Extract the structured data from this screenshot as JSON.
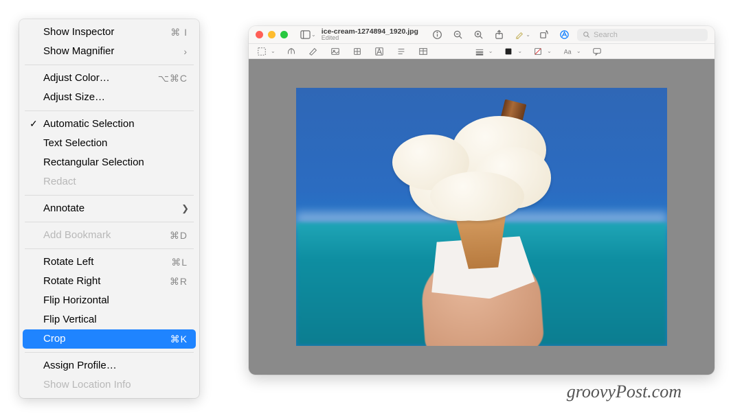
{
  "menu": {
    "groups": [
      [
        {
          "label": "Show Inspector",
          "shortcut": "⌘ I"
        },
        {
          "label": "Show Magnifier",
          "shortcut": "›"
        }
      ],
      [
        {
          "label": "Adjust Color…",
          "shortcut": "⌥⌘C"
        },
        {
          "label": "Adjust Size…"
        }
      ],
      [
        {
          "label": "Automatic Selection",
          "checked": true
        },
        {
          "label": "Text Selection"
        },
        {
          "label": "Rectangular Selection"
        },
        {
          "label": "Redact",
          "disabled": true
        }
      ],
      [
        {
          "label": "Annotate",
          "submenu": true
        }
      ],
      [
        {
          "label": "Add Bookmark",
          "shortcut": "⌘D",
          "disabled": true
        }
      ],
      [
        {
          "label": "Rotate Left",
          "shortcut": "⌘L"
        },
        {
          "label": "Rotate Right",
          "shortcut": "⌘R"
        },
        {
          "label": "Flip Horizontal"
        },
        {
          "label": "Flip Vertical"
        },
        {
          "label": "Crop",
          "shortcut": "⌘K",
          "highlight": true
        }
      ],
      [
        {
          "label": "Assign Profile…"
        },
        {
          "label": "Show Location Info",
          "disabled": true
        }
      ]
    ]
  },
  "window": {
    "filename": "ice-cream-1274894_1920.jpg",
    "subtitle": "Edited",
    "search_placeholder": "Search",
    "toolbar1_icons": [
      "sidebar-toggle-icon",
      "info-icon",
      "zoom-out-icon",
      "zoom-in-icon",
      "share-icon",
      "highlighter-icon",
      "rotate-icon",
      "markup-icon"
    ],
    "toolbar2_icons": [
      "selection-icon",
      "instant-alpha-icon",
      "lasso-icon",
      "smart-lasso-icon",
      "crop-mask-icon",
      "annotate-text-icon",
      "align-icon",
      "table-icon",
      "line-style-icon",
      "fill-color-icon",
      "stroke-color-icon",
      "text-style-icon",
      "speech-bubble-icon"
    ]
  },
  "watermark": "groovyPost.com"
}
